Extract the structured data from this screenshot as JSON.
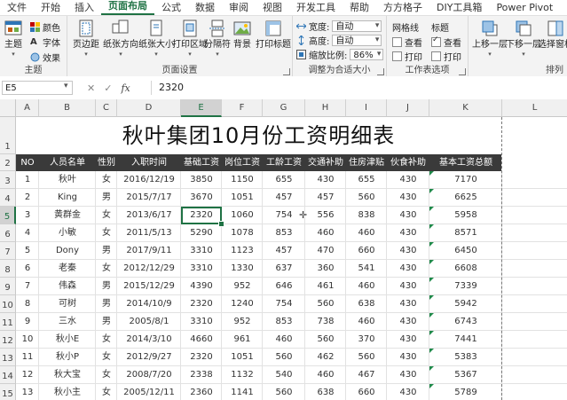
{
  "ribbon_tabs": [
    {
      "label": "文件",
      "active": false
    },
    {
      "label": "开始",
      "active": false
    },
    {
      "label": "插入",
      "active": false
    },
    {
      "label": "页面布局",
      "active": true
    },
    {
      "label": "公式",
      "active": false
    },
    {
      "label": "数据",
      "active": false
    },
    {
      "label": "审阅",
      "active": false
    },
    {
      "label": "视图",
      "active": false
    },
    {
      "label": "开发工具",
      "active": false
    },
    {
      "label": "帮助",
      "active": false
    },
    {
      "label": "方方格子",
      "active": false
    },
    {
      "label": "DIY工具箱",
      "active": false
    },
    {
      "label": "Power Pivot",
      "active": false
    }
  ],
  "ribbon": {
    "theme": {
      "big_label": "主题",
      "colors": "颜色",
      "fonts": "字体",
      "effects": "效果",
      "group": "主题"
    },
    "page_setup": {
      "margins": "页边距",
      "orientation": "纸张方向",
      "size": "纸张大小",
      "print_area": "打印区域",
      "breaks": "分隔符",
      "background": "背景",
      "print_titles": "打印标题",
      "group": "页面设置"
    },
    "scale": {
      "width_label": "宽度:",
      "width_value": "自动",
      "height_label": "高度:",
      "height_value": "自动",
      "scale_label": "缩放比例:",
      "scale_value": "86%",
      "group": "调整为合适大小"
    },
    "sheet_options": {
      "gridlines": "网格线",
      "headings": "标题",
      "view": "查看",
      "print": "打印",
      "group": "工作表选项",
      "gridlines_view": false,
      "gridlines_print": false,
      "headings_view": true,
      "headings_print": false
    },
    "arrange": {
      "bring_forward": "上移一层",
      "send_backward": "下移一层",
      "selection_pane": "选择窗格",
      "group": "排列"
    }
  },
  "formula_bar": {
    "name_box": "E5",
    "formula": "2320",
    "fx": "fx",
    "cancel": "✕",
    "enter": "✓"
  },
  "sheet": {
    "columns": [
      "A",
      "B",
      "C",
      "D",
      "E",
      "F",
      "G",
      "H",
      "I",
      "J",
      "K",
      "L"
    ],
    "selected_column": "E",
    "selected_row": "5",
    "row_numbers": [
      "1",
      "2",
      "3",
      "4",
      "5",
      "6",
      "7",
      "8",
      "9",
      "10",
      "11",
      "12",
      "13",
      "14",
      "15"
    ],
    "title": "秋叶集团10月份工资明细表",
    "headers": [
      "NO",
      "人员名单",
      "性别",
      "入职时间",
      "基础工资",
      "岗位工资",
      "工龄工资",
      "交通补助",
      "住房津贴",
      "伙食补助",
      "基本工资总额"
    ],
    "rows": [
      [
        "1",
        "秋叶",
        "女",
        "2016/12/19",
        "3850",
        "1150",
        "655",
        "430",
        "655",
        "430",
        "7170"
      ],
      [
        "2",
        "King",
        "男",
        "2015/7/17",
        "3670",
        "1051",
        "457",
        "457",
        "560",
        "430",
        "6625"
      ],
      [
        "3",
        "黄群金",
        "女",
        "2013/6/17",
        "2320",
        "1060",
        "754",
        "556",
        "838",
        "430",
        "5958"
      ],
      [
        "4",
        "小敏",
        "女",
        "2011/5/13",
        "5290",
        "1078",
        "853",
        "460",
        "460",
        "430",
        "8571"
      ],
      [
        "5",
        "Dony",
        "男",
        "2017/9/11",
        "3310",
        "1123",
        "457",
        "470",
        "660",
        "430",
        "6450"
      ],
      [
        "6",
        "老秦",
        "女",
        "2012/12/29",
        "3310",
        "1330",
        "637",
        "360",
        "541",
        "430",
        "6608"
      ],
      [
        "7",
        "伟森",
        "男",
        "2015/12/29",
        "4390",
        "952",
        "646",
        "461",
        "460",
        "430",
        "7339"
      ],
      [
        "8",
        "可树",
        "男",
        "2014/10/9",
        "2320",
        "1240",
        "754",
        "560",
        "638",
        "430",
        "5942"
      ],
      [
        "9",
        "三水",
        "男",
        "2005/8/1",
        "3310",
        "952",
        "853",
        "738",
        "460",
        "430",
        "6743"
      ],
      [
        "10",
        "秋小E",
        "女",
        "2014/3/10",
        "4660",
        "961",
        "460",
        "560",
        "370",
        "430",
        "7441"
      ],
      [
        "11",
        "秋小P",
        "女",
        "2012/9/27",
        "2320",
        "1051",
        "560",
        "462",
        "560",
        "430",
        "5383"
      ],
      [
        "12",
        "秋大宝",
        "女",
        "2008/7/20",
        "2338",
        "1132",
        "540",
        "460",
        "467",
        "430",
        "5367"
      ],
      [
        "13",
        "秋小主",
        "女",
        "2005/12/11",
        "2360",
        "1141",
        "560",
        "638",
        "660",
        "430",
        "5789"
      ]
    ]
  }
}
